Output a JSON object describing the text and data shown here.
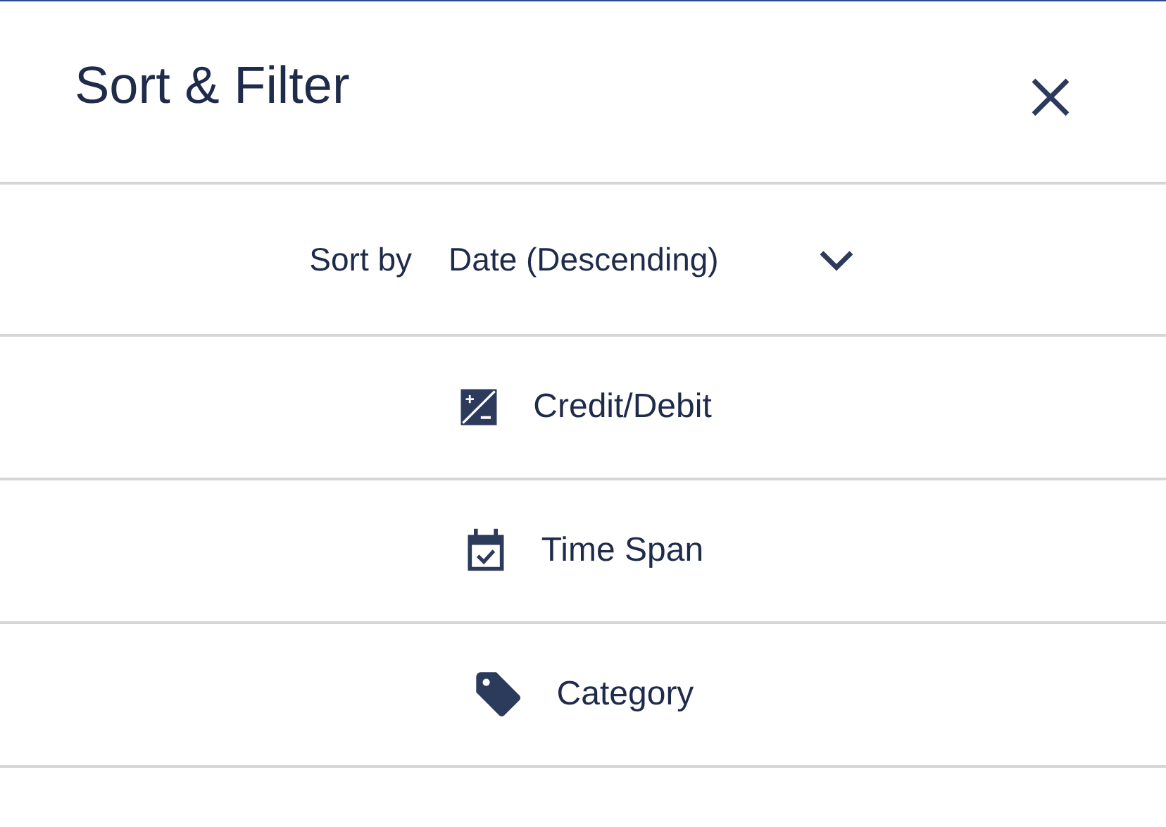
{
  "header": {
    "title": "Sort & Filter"
  },
  "sort": {
    "label": "Sort by",
    "value": "Date (Descending)"
  },
  "filters": [
    {
      "kind": "credit_debit",
      "label": "Credit/Debit"
    },
    {
      "kind": "time_span",
      "label": "Time Span"
    },
    {
      "kind": "category",
      "label": "Category"
    }
  ]
}
